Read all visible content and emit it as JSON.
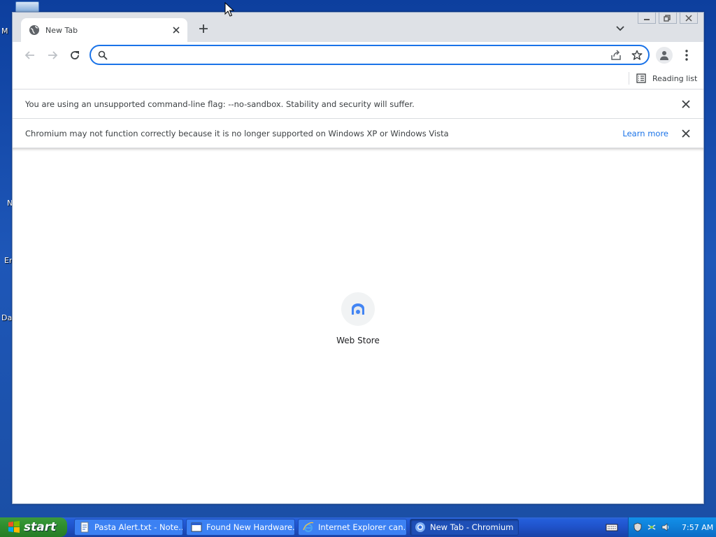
{
  "desktop": {
    "icon_labels": [
      "M",
      "N",
      "Er",
      "Da"
    ]
  },
  "browser": {
    "tab": {
      "title": "New Tab"
    },
    "omnibox": {
      "value": "",
      "placeholder": ""
    },
    "bookmarks": {
      "reading_list_label": "Reading list"
    },
    "infobars": [
      {
        "text": "You are using an unsupported command-line flag: --no-sandbox. Stability and security will suffer."
      },
      {
        "text": "Chromium may not function correctly because it is no longer supported on Windows XP or Windows Vista",
        "link": "Learn more"
      }
    ],
    "ntp": {
      "shortcut_label": "Web Store"
    },
    "accent_color": "#1a73e8"
  },
  "taskbar": {
    "start_label": "start",
    "items": [
      {
        "label": "Pasta Alert.txt - Note...",
        "icon": "notepad-icon"
      },
      {
        "label": "Found New Hardware...",
        "icon": "window-icon"
      },
      {
        "label": "Internet Explorer can...",
        "icon": "internet-explorer-icon"
      },
      {
        "label": "New Tab - Chromium",
        "icon": "chromium-icon"
      }
    ],
    "clock": "7:57 AM"
  }
}
